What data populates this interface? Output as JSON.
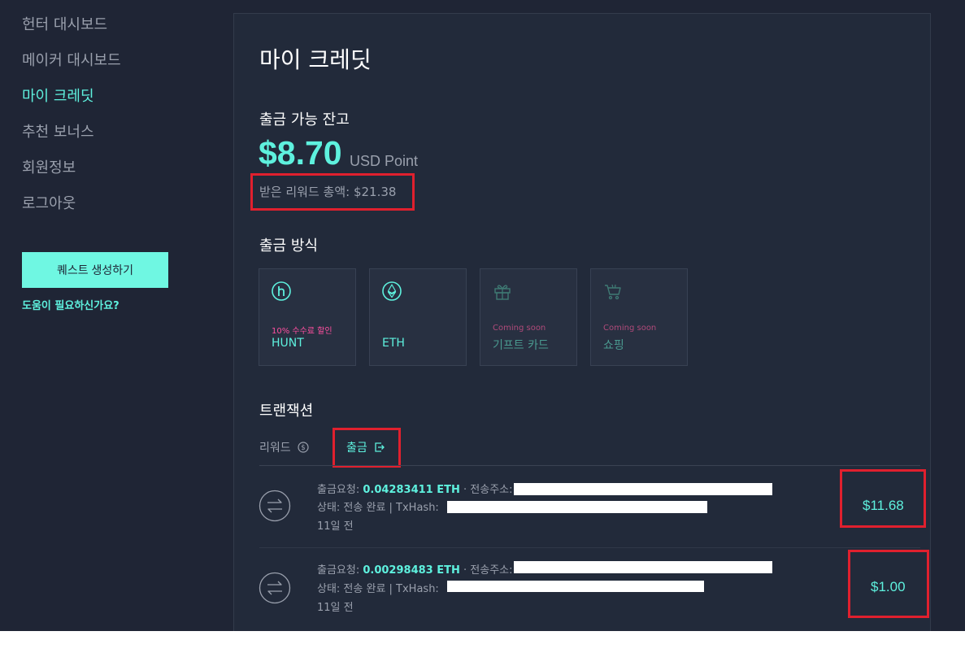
{
  "sidebar": {
    "items": [
      {
        "label": "헌터 대시보드"
      },
      {
        "label": "메이커 대시보드"
      },
      {
        "label": "마이 크레딧"
      },
      {
        "label": "추천 보너스"
      },
      {
        "label": "회원정보"
      },
      {
        "label": "로그아웃"
      }
    ],
    "quest_button": "퀘스트 생성하기",
    "help_link": "도움이 필요하신가요?"
  },
  "main": {
    "title": "마이 크레딧",
    "balance": {
      "label": "출금 가능 잔고",
      "amount": "$8.70",
      "unit": "USD Point",
      "total_reward": "받은 리워드 총액: $21.38"
    },
    "withdraw_methods": {
      "label": "출금 방식",
      "cards": [
        {
          "sub": "10% 수수료 할인",
          "name": "HUNT",
          "icon": "hunt-icon"
        },
        {
          "sub": "",
          "name": "ETH",
          "icon": "eth-icon"
        },
        {
          "sub": "Coming soon",
          "name": "기프트 카드",
          "icon": "gift-icon"
        },
        {
          "sub": "Coming soon",
          "name": "쇼핑",
          "icon": "cart-icon"
        }
      ]
    },
    "transactions": {
      "label": "트랜잭션",
      "tabs": {
        "reward": "리워드",
        "withdraw": "출금"
      },
      "items": [
        {
          "request_prefix": "출금요청: ",
          "eth_amount": "0.04283411 ETH",
          "address_label": " · 전송주소:",
          "status": "상태: 전송 완료 | TxHash:",
          "date": "11일 전",
          "amount": "$11.68"
        },
        {
          "request_prefix": "출금요청: ",
          "eth_amount": "0.00298483 ETH",
          "address_label": " · 전송주소:",
          "status": "상태: 전송 완료 | TxHash:",
          "date": "11일 전",
          "amount": "$1.00"
        }
      ]
    }
  },
  "colors": {
    "background": "#1f2535",
    "panel": "#222a3a",
    "accent": "#5ef1de",
    "button": "#6ff7e2",
    "pink": "#ff4fa0",
    "highlight_box": "#e0202e"
  }
}
